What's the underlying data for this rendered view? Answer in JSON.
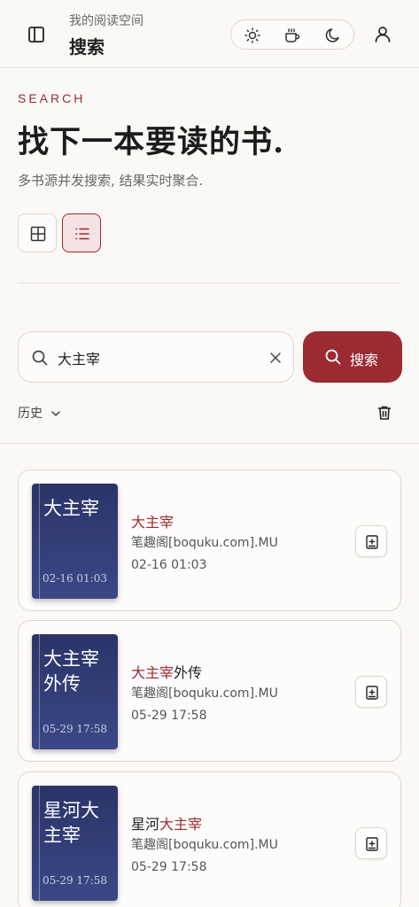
{
  "header": {
    "subtitle": "我的阅读空间",
    "title": "搜索"
  },
  "hero": {
    "eyebrow": "SEARCH",
    "headline": "找下一本要读的书.",
    "description": "多书源并发搜索, 结果实时聚合."
  },
  "search": {
    "query": "大主宰",
    "button_label": "搜索"
  },
  "history": {
    "label": "历史"
  },
  "results": [
    {
      "cover_title": "大主宰",
      "cover_date": "02-16 01:03",
      "title_highlight": "大主宰",
      "title_rest": "",
      "source": "笔趣阁[boquku.com].MU",
      "time": "02-16 01:03"
    },
    {
      "cover_title": "大主宰外传",
      "cover_date": "05-29 17:58",
      "title_highlight": "大主宰",
      "title_rest": "外传",
      "source": "笔趣阁[boquku.com].MU",
      "time": "05-29 17:58"
    },
    {
      "cover_title": "星河大主宰",
      "cover_date": "05-29 17:58",
      "title_prefix": "星河",
      "title_highlight": "大主宰",
      "source": "笔趣阁[boquku.com].MU",
      "time": "05-29 17:58"
    }
  ],
  "colors": {
    "accent": "#9b2a31",
    "background": "#faf9f6",
    "cover": "#2b3468"
  }
}
